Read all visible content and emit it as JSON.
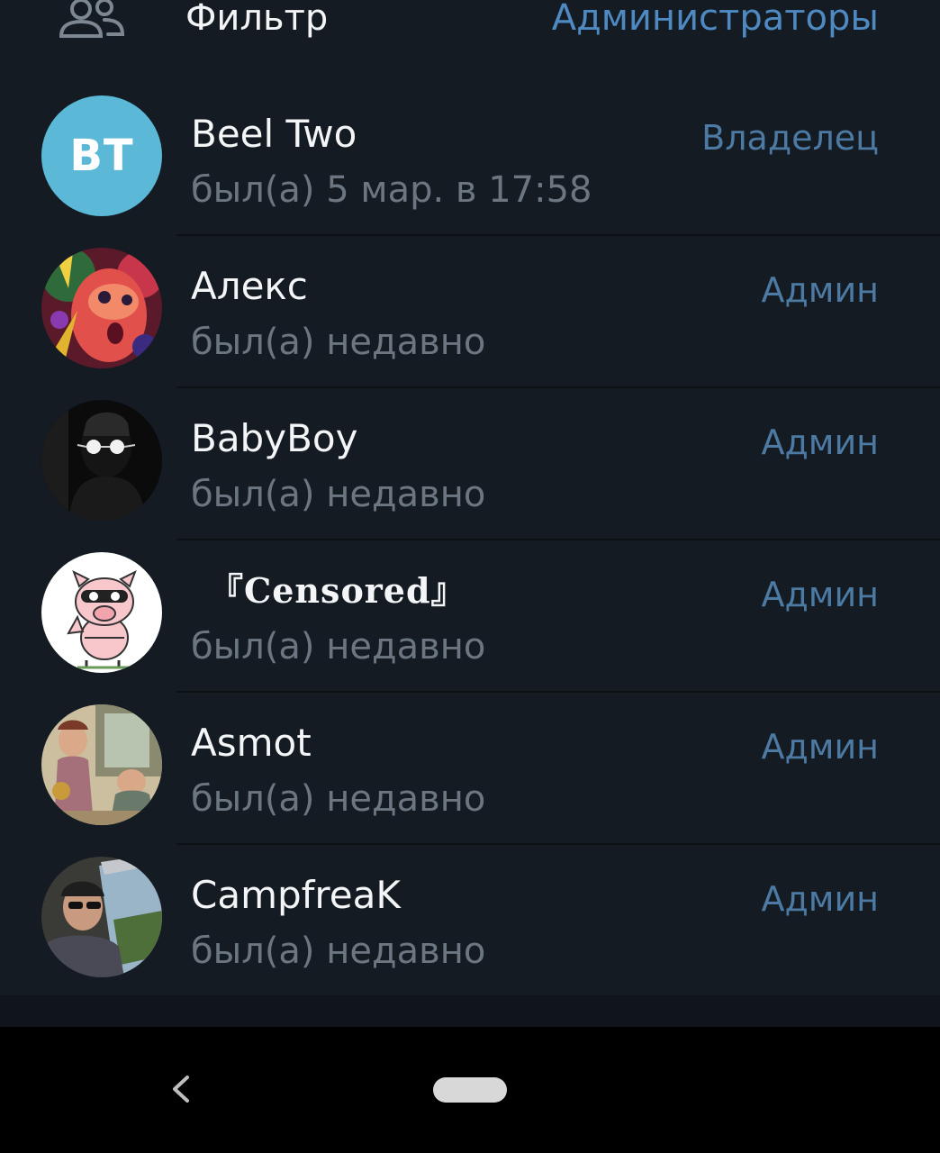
{
  "filter": {
    "icon": "group-icon",
    "label": "Фильтр",
    "value": "Администраторы"
  },
  "members": [
    {
      "name": "Beel Two",
      "status": "был(а) 5 мар. в 17:58",
      "role": "Владелец",
      "avatar": {
        "type": "initials",
        "initials": "BT",
        "color": "#5bb9d7"
      }
    },
    {
      "name": "Алекс",
      "status": "был(а) недавно",
      "role": "Админ",
      "avatar": {
        "type": "photo",
        "description": "psychedelic-face-art"
      }
    },
    {
      "name": "BabyBoy",
      "status": "был(а) недавно",
      "role": "Админ",
      "avatar": {
        "type": "photo",
        "description": "dark-silhouette-glasses"
      }
    },
    {
      "name": "『Censored』",
      "status": "был(а) недавно",
      "role": "Админ",
      "avatar": {
        "type": "photo",
        "description": "cartoon-pig"
      }
    },
    {
      "name": "Asmot",
      "status": "был(а) недавно",
      "role": "Админ",
      "avatar": {
        "type": "photo",
        "description": "vintage-illustration"
      }
    },
    {
      "name": "CampfreaK",
      "status": "был(а) недавно",
      "role": "Админ",
      "avatar": {
        "type": "photo",
        "description": "man-in-car-sunglasses"
      }
    }
  ],
  "navbar": {
    "back_icon": "back-chevron-icon",
    "home_icon": "home-pill-icon"
  },
  "colors": {
    "background": "#141b23",
    "accent": "#4e8ac1",
    "role_text": "#4c7aa3",
    "secondary_text": "#6b7681"
  }
}
